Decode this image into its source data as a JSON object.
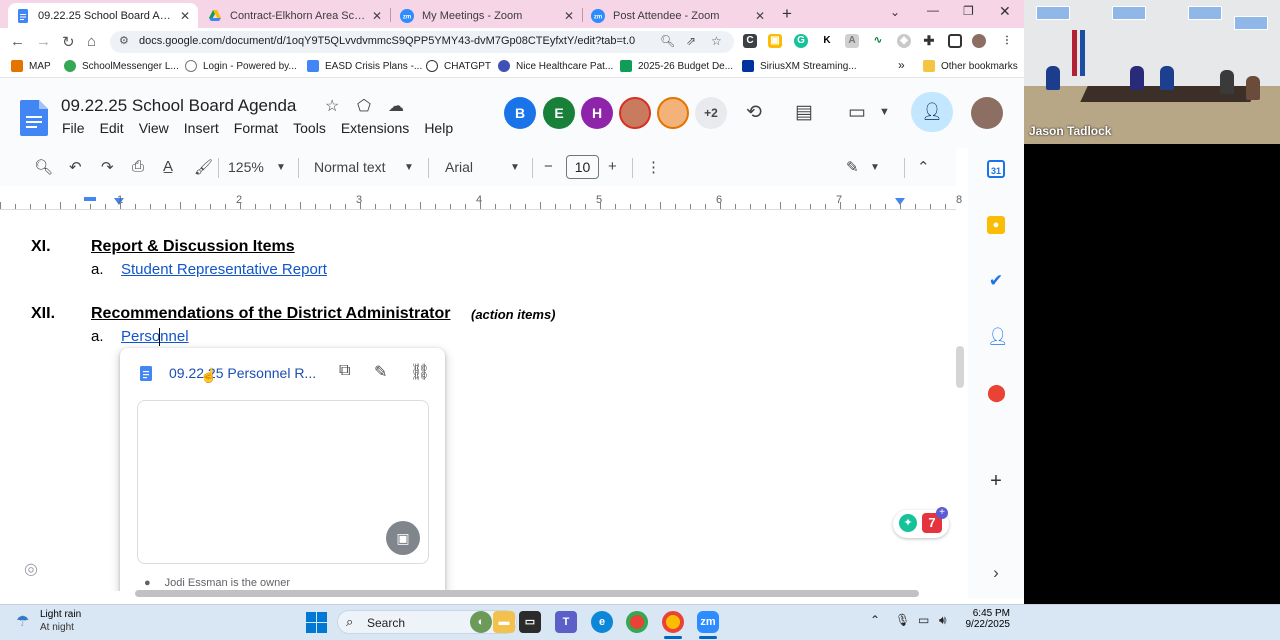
{
  "browser": {
    "tabs": [
      {
        "title": "09.22.25 School Board Agenda - Google Docs",
        "active": true,
        "icon": "docs-icon"
      },
      {
        "title": "Contract-Elkhorn Area School District",
        "active": false,
        "icon": "drive-icon"
      },
      {
        "title": "My Meetings - Zoom",
        "active": false,
        "icon": "zoom-icon"
      },
      {
        "title": "Post Attendee - Zoom",
        "active": false,
        "icon": "zoom-icon"
      }
    ],
    "new_tab": "+",
    "url": "docs.google.com/document/d/1oqY9T5QLvvdvmmcS9QPP5YMY43-dvM7Gp08CTEyfxtY/edit?tab=t.0",
    "bookmarks": [
      "MAP",
      "SchoolMessenger L...",
      "Login - Powered by...",
      "EASD Crisis Plans -...",
      "CHATGPT",
      "Nice Healthcare Pat...",
      "2025-26 Budget De...",
      "SiriusXM Streaming..."
    ],
    "bookmarks_more": "»",
    "other_bookmarks": "Other bookmarks"
  },
  "docs": {
    "title": "09.22.25 School Board Agenda",
    "menu": [
      "File",
      "Edit",
      "View",
      "Insert",
      "Format",
      "Tools",
      "Extensions",
      "Help"
    ],
    "collaborators": [
      {
        "initial": "B",
        "color": "#1a73e8"
      },
      {
        "initial": "E",
        "color": "#188038"
      },
      {
        "initial": "H",
        "color": "#8e24aa"
      }
    ],
    "extra_collaborators": "+2",
    "toolbar": {
      "zoom": "125%",
      "style": "Normal text",
      "font": "Arial",
      "font_size": "10"
    },
    "ruler_numbers": [
      "1",
      "2",
      "3",
      "4",
      "5",
      "6",
      "7",
      "8"
    ]
  },
  "document": {
    "sections": [
      {
        "number": "XI.",
        "heading": "Report & Discussion Items",
        "note": "",
        "items": [
          {
            "letter": "a.",
            "text": "Student Representative Report"
          }
        ]
      },
      {
        "number": "XII.",
        "heading": "Recommendations of the District Administrator",
        "note": "(action items)",
        "items": [
          {
            "letter": "a.",
            "text": "Personnel"
          }
        ]
      }
    ],
    "link_card": {
      "title": "09.22.25 Personnel R...",
      "owner": "Jodi Essman is the owner"
    }
  },
  "grammarly": {
    "count": "7"
  },
  "zoom_video": {
    "participant_name": "Jason Tadlock"
  },
  "taskbar": {
    "weather_title": "Light rain",
    "weather_subtitle": "At night",
    "search_label": "Search",
    "time": "6:45 PM",
    "date": "9/22/2025"
  }
}
